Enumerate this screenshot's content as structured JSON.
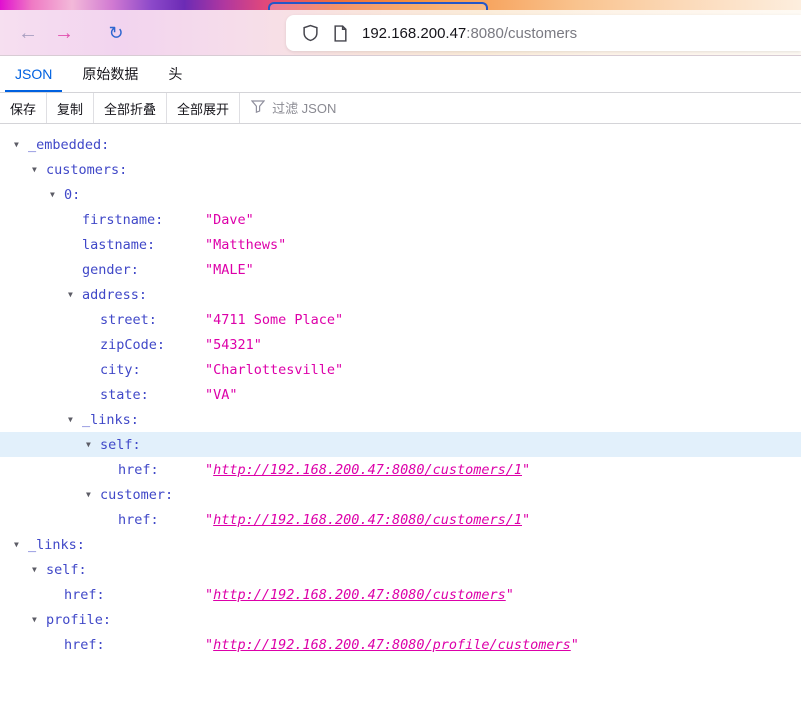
{
  "browser": {
    "back_icon": "←",
    "forward_icon": "→",
    "reload_icon": "↻",
    "url_host": "192.168.200.47",
    "url_path": ":8080/customers"
  },
  "tabs": [
    {
      "label": "JSON",
      "active": true
    },
    {
      "label": "原始数据",
      "active": false
    },
    {
      "label": "头",
      "active": false
    }
  ],
  "toolbar": {
    "save": "保存",
    "copy": "复制",
    "collapse_all": "全部折叠",
    "expand_all": "全部展开",
    "filter_placeholder": "过滤 JSON"
  },
  "colors": {
    "accent_blue": "#0061e0",
    "key_color": "#4048c8",
    "string_color": "#dd00a9",
    "highlight_row": "#e2f0fb"
  },
  "tree": {
    "rows": [
      {
        "key": "_embedded",
        "level": 0,
        "expandable": true
      },
      {
        "key": "customers",
        "level": 1,
        "expandable": true
      },
      {
        "key": "0",
        "level": 2,
        "expandable": true
      },
      {
        "key": "firstname",
        "level": 3,
        "type": "string",
        "value": "Dave"
      },
      {
        "key": "lastname",
        "level": 3,
        "type": "string",
        "value": "Matthews"
      },
      {
        "key": "gender",
        "level": 3,
        "type": "string",
        "value": "MALE"
      },
      {
        "key": "address",
        "level": 3,
        "expandable": true
      },
      {
        "key": "street",
        "level": 4,
        "type": "string",
        "value": "4711 Some Place"
      },
      {
        "key": "zipCode",
        "level": 4,
        "type": "string",
        "value": "54321"
      },
      {
        "key": "city",
        "level": 4,
        "type": "string",
        "value": "Charlottesville"
      },
      {
        "key": "state",
        "level": 4,
        "type": "string",
        "value": "VA"
      },
      {
        "key": "_links",
        "level": 3,
        "expandable": true
      },
      {
        "key": "self",
        "level": 4,
        "expandable": true,
        "highlighted": true
      },
      {
        "key": "href",
        "level": 5,
        "type": "link",
        "value": "http://192.168.200.47:8080/customers/1"
      },
      {
        "key": "customer",
        "level": 4,
        "expandable": true
      },
      {
        "key": "href",
        "level": 5,
        "type": "link",
        "value": "http://192.168.200.47:8080/customers/1"
      },
      {
        "key": "_links",
        "level": 0,
        "expandable": true
      },
      {
        "key": "self",
        "level": 1,
        "expandable": true
      },
      {
        "key": "href",
        "level": 2,
        "type": "link",
        "value": "http://192.168.200.47:8080/customers"
      },
      {
        "key": "profile",
        "level": 1,
        "expandable": true
      },
      {
        "key": "href",
        "level": 2,
        "type": "link",
        "value": "http://192.168.200.47:8080/profile/customers"
      }
    ]
  }
}
